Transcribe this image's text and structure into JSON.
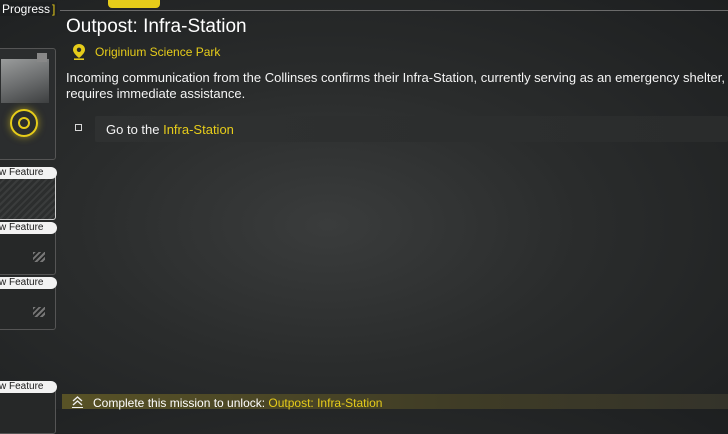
{
  "header": {
    "progress_label": "Progress",
    "progress_bracket": "]"
  },
  "sidebar": {
    "new_feature_labels": [
      "w Feature",
      "w Feature",
      "w Feature",
      "w Feature"
    ]
  },
  "mission": {
    "title": "Outpost: Infra-Station",
    "location": "Originium Science Park",
    "description": "Incoming communication from the Collinses confirms their Infra-Station, currently serving as an emergency shelter, requires immediate assistance.",
    "task_prefix": "Go to the ",
    "task_target": "Infra-Station"
  },
  "footer": {
    "unlock_prefix": "Complete this mission to unlock: ",
    "unlock_target": "Outpost: Infra-Station"
  },
  "colors": {
    "accent": "#e6cc1a",
    "background": "#2a2c2c"
  },
  "icons": {
    "location": "map-pin-icon",
    "unlock": "double-chevron-up-icon",
    "target": "target-ring-icon"
  }
}
